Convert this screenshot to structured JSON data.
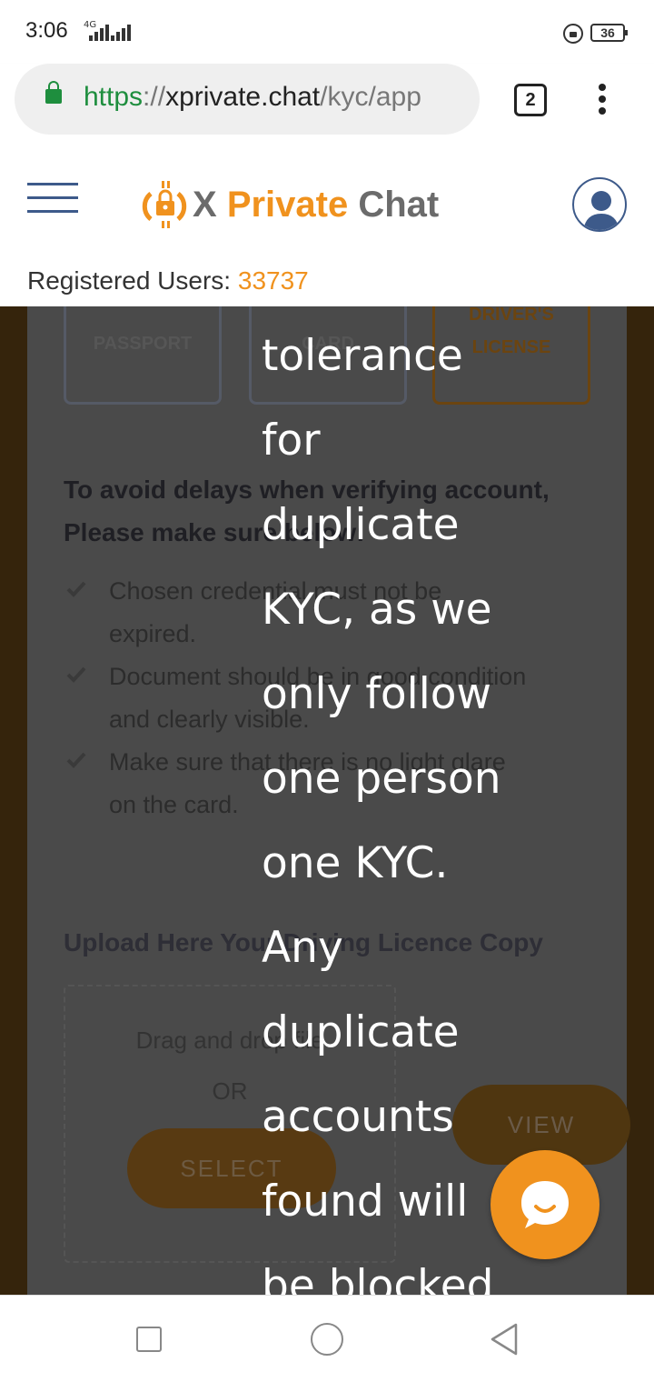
{
  "status_bar": {
    "time": "3:06",
    "network": "4G",
    "battery": "36"
  },
  "browser": {
    "url_scheme": "https",
    "url_sep": "://",
    "url_host": "xprivate.chat",
    "url_path": "/kyc/app",
    "tab_count": "2"
  },
  "header": {
    "logo_x": "X",
    "logo_private": "Private",
    "logo_chat": "Chat",
    "registered_label": "Registered Users:",
    "registered_count": "33737"
  },
  "documents": {
    "passport": "PASSPORT",
    "id_card": "CARD",
    "drivers_license_line1": "DRIVER'S",
    "drivers_license_line2": "LICENSE"
  },
  "instructions": {
    "heading_line1": "To avoid delays when verifying account,",
    "heading_line2": "Please make sure below:",
    "items": [
      {
        "line1": "Chosen credential must not be",
        "line2": "expired."
      },
      {
        "line1": "Document should be in good condition",
        "line2": "and clearly visible."
      },
      {
        "line1": "Make sure that there is no light glare",
        "line2": "on the card."
      }
    ]
  },
  "upload": {
    "title": "Upload Here Your Driving Licence Copy",
    "drop_text": "Drag and drop file",
    "or_text": "OR",
    "select_label": "SELECT",
    "view_label": "VIEW"
  },
  "overlay": {
    "lines": [
      "tolerance",
      "for",
      "duplicate",
      "KYC, as we",
      "only follow",
      "one person",
      "one KYC.",
      "Any",
      "duplicate",
      "accounts",
      "found will",
      "be blocked."
    ]
  },
  "colors": {
    "brand_orange": "#f0921e",
    "url_green": "#1e8e3e",
    "header_blue": "#3d5a8a"
  },
  "icons": {
    "lock": "lock-icon",
    "menu": "hamburger-menu-icon",
    "user": "user-avatar-icon",
    "chat": "chat-bubble-icon",
    "check": "checkmark-icon"
  }
}
